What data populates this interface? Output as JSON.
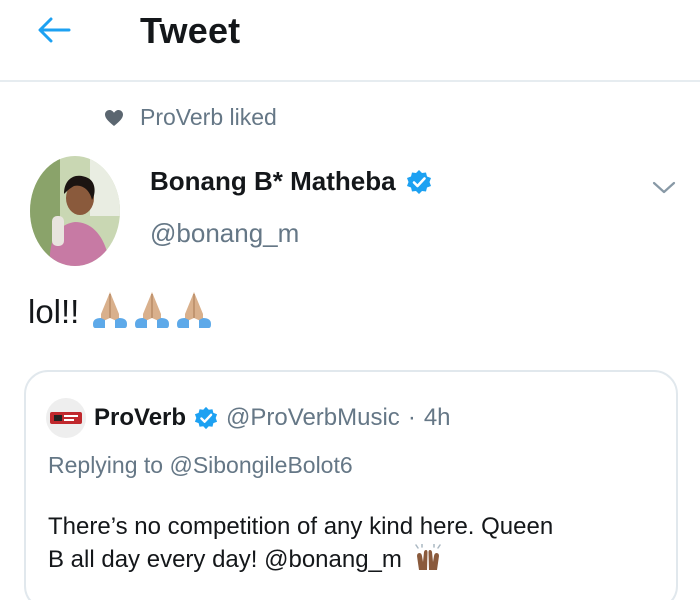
{
  "header": {
    "title": "Tweet"
  },
  "social_context": {
    "text": "ProVerb liked"
  },
  "tweet": {
    "author_name": "Bonang B* Matheba",
    "author_handle": "@bonang_m",
    "text": "lol!!",
    "emoji": [
      "folded-hands-emoji",
      "folded-hands-emoji",
      "folded-hands-emoji"
    ]
  },
  "quoted_tweet": {
    "author_name": "ProVerb",
    "author_handle": "@ProVerbMusic",
    "separator": "·",
    "time": "4h",
    "replying_prefix": "Replying to",
    "replying_to": "@SibongileBolot6",
    "body_line1": "There’s no competition of any kind here. Queen",
    "body_line2": "B all day every day! @bonang_m",
    "trailing_emoji": "raising-hands-emoji"
  },
  "colors": {
    "accent": "#1da1f2",
    "secondary_text": "#657786",
    "primary_text": "#14171a",
    "border": "#e1e8ed"
  }
}
